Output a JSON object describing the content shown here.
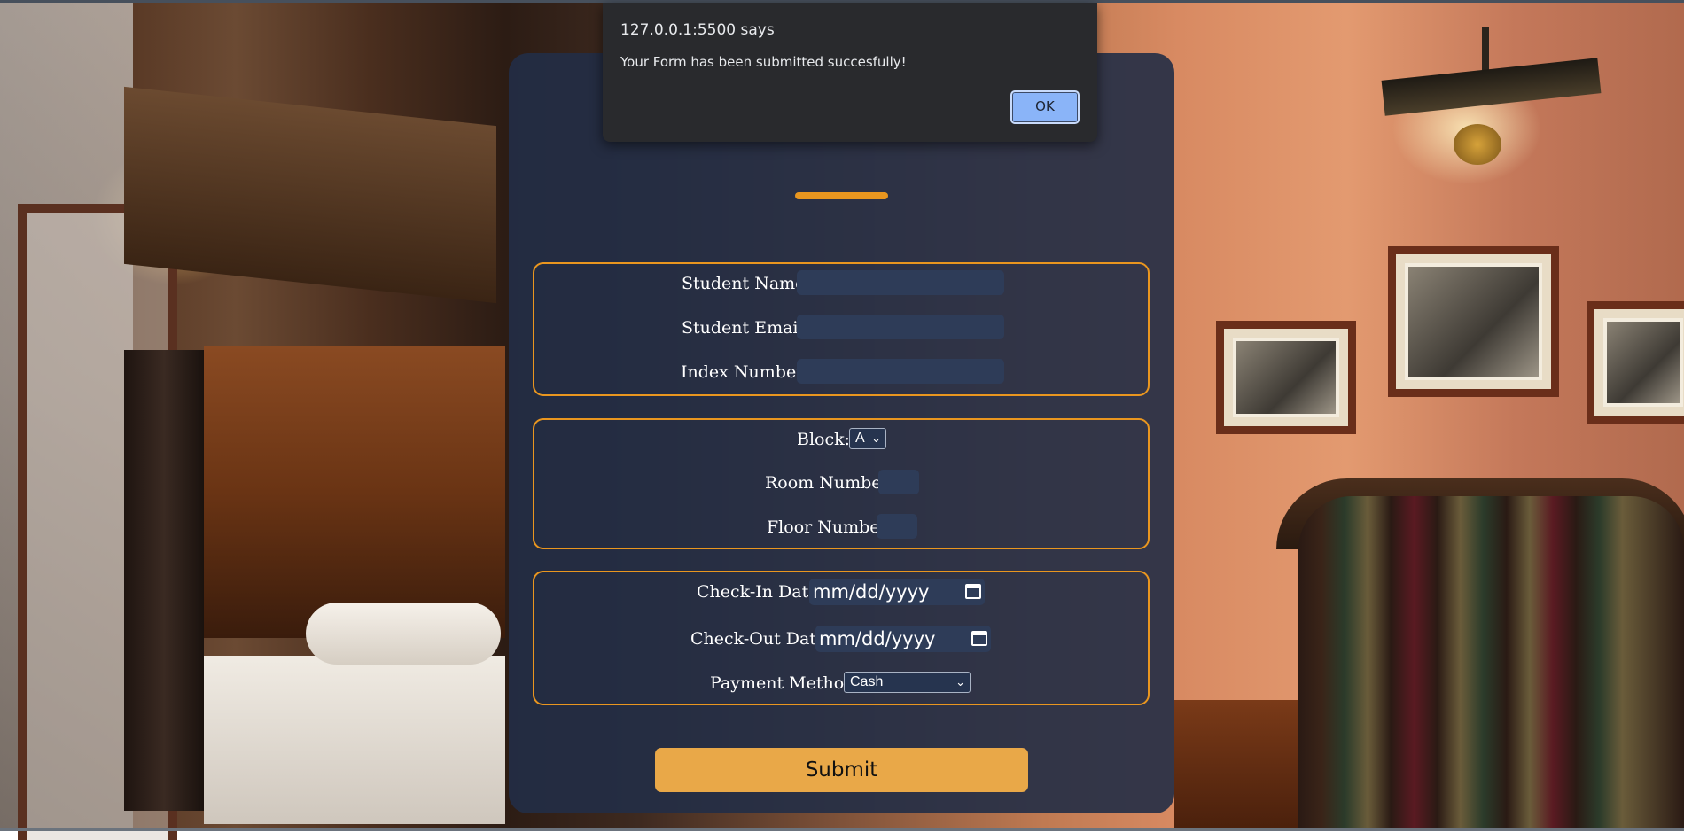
{
  "dialog": {
    "origin": "127.0.0.1:5500 says",
    "message": "Your Form has been submitted succesfully!",
    "ok_label": "OK"
  },
  "form": {
    "student": {
      "name_label": "Student Name:",
      "email_label": "Student Email:",
      "index_label": "Index Number:"
    },
    "room": {
      "block_label": "Block:",
      "block_value": "A",
      "room_label": "Room Number:",
      "floor_label": "Floor Number:"
    },
    "booking": {
      "checkin_label": "Check-In Date:",
      "checkin_placeholder": "mm/dd/yyyy",
      "checkout_label": "Check-Out Date:",
      "checkout_placeholder": "mm/dd/yyyy",
      "payment_label": "Payment Method:",
      "payment_value": "Cash"
    },
    "submit_label": "Submit"
  },
  "colors": {
    "accent": "#e9961f",
    "button": "#e9a848",
    "card": "#222e46",
    "dialog": "#292a2d",
    "ok_button": "#8ab4f8"
  },
  "icons": [
    "calendar-icon",
    "chevron-down-icon"
  ]
}
